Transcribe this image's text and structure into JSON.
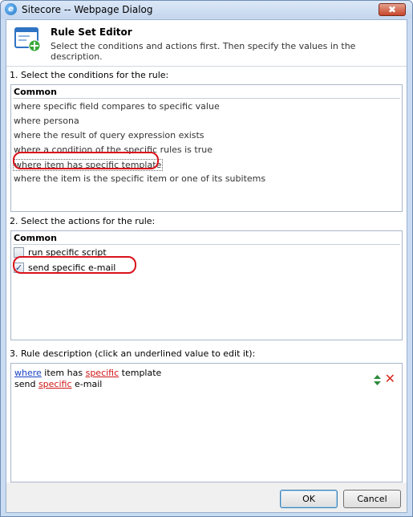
{
  "window": {
    "title": "Sitecore -- Webpage Dialog",
    "close_glyph": "✖",
    "app_icon_glyph": "e"
  },
  "header": {
    "title": "Rule Set Editor",
    "subtitle": "Select the conditions and actions first. Then specify the values in the description."
  },
  "conditions": {
    "label": "1. Select the conditions for the rule:",
    "group": "Common",
    "items": [
      "where specific field compares to specific value",
      "where persona",
      "where the result of query expression exists",
      "where a condition of the specific rules is true",
      "where item has specific template",
      "where the item is the specific item or one of its subitems"
    ],
    "selected_index": 4
  },
  "actions": {
    "label": "2. Select the actions for the rule:",
    "group": "Common",
    "items": [
      {
        "label": "run specific script",
        "checked": false
      },
      {
        "label": "send specific e-mail",
        "checked": true
      }
    ],
    "check_glyph": "✓"
  },
  "description": {
    "label": "3. Rule description (click an underlined value to edit it):",
    "line1": {
      "link1": "where",
      "text1": " item has ",
      "link2": "specific",
      "text2": " template"
    },
    "line2": {
      "text1": "send ",
      "link1": "specific",
      "text2": " e-mail"
    },
    "remove_glyph": "✕"
  },
  "buttons": {
    "ok": "OK",
    "cancel": "Cancel"
  },
  "colors": {
    "annotation": "#d9121b",
    "link_blue": "#1a43c4",
    "link_red": "#d01616"
  }
}
